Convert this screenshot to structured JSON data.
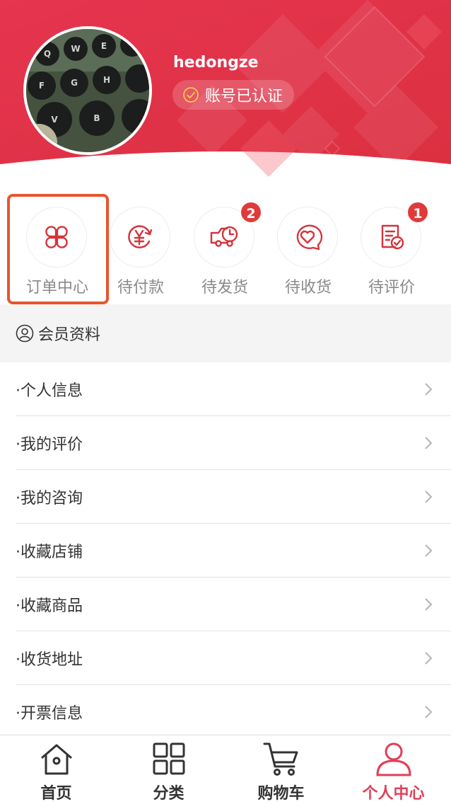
{
  "colors": {
    "brand": "#e23e57",
    "header_bg": "#e63b57",
    "badge": "#e03b3b",
    "highlight": "#e8552d",
    "icon": "#d6323b"
  },
  "profile": {
    "username": "hedongze",
    "verified_text": "账号已认证"
  },
  "orders": [
    {
      "label": "订单中心",
      "icon": "clover-grid-icon",
      "badge": ""
    },
    {
      "label": "待付款",
      "icon": "yen-refresh-icon",
      "badge": ""
    },
    {
      "label": "待发货",
      "icon": "delivery-truck-icon",
      "badge": "2"
    },
    {
      "label": "待收货",
      "icon": "heart-chat-icon",
      "badge": ""
    },
    {
      "label": "待评价",
      "icon": "document-check-icon",
      "badge": "1"
    }
  ],
  "member": {
    "title": "会员资料",
    "items": [
      {
        "label": "·个人信息"
      },
      {
        "label": "·我的评价"
      },
      {
        "label": "·我的咨询"
      },
      {
        "label": "·收藏店铺"
      },
      {
        "label": "·收藏商品"
      },
      {
        "label": "·收货地址"
      },
      {
        "label": "·开票信息"
      }
    ]
  },
  "tabs": [
    {
      "label": "首页",
      "icon": "home-icon",
      "active": false
    },
    {
      "label": "分类",
      "icon": "grid-icon",
      "active": false
    },
    {
      "label": "购物车",
      "icon": "cart-icon",
      "active": false
    },
    {
      "label": "个人中心",
      "icon": "user-icon",
      "active": true
    }
  ]
}
